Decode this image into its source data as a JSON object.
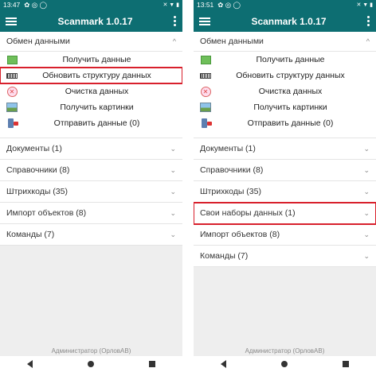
{
  "phones": [
    {
      "time": "13:47",
      "status_icons": "✿ ◎ ◯",
      "sys_icons": "✕ ▼ ▮",
      "app_title": "Scanmark 1.0.17",
      "exchange": {
        "label": "Обмен данными",
        "items": [
          {
            "label": "Получить данные",
            "icon": "device-green-icon"
          },
          {
            "label": "Обновить структуру данных",
            "icon": "barcode-xml-icon"
          },
          {
            "label": "Очистка данных",
            "icon": "clear-icon"
          },
          {
            "label": "Получить картинки",
            "icon": "picture-icon"
          },
          {
            "label": "Отправить данные (0)",
            "icon": "send-icon"
          }
        ]
      },
      "rows": [
        {
          "label": "Документы (1)"
        },
        {
          "label": "Справочники (8)"
        },
        {
          "label": "Штрихкоды (35)"
        },
        {
          "label": "Импорт объектов (8)"
        },
        {
          "label": "Команды (7)"
        }
      ],
      "footer": "Администратор (ОрловАВ)"
    },
    {
      "time": "13:51",
      "status_icons": "✿ ◎ ◯",
      "sys_icons": "✕ ▼ ▮",
      "app_title": "Scanmark 1.0.17",
      "exchange": {
        "label": "Обмен данными",
        "items": [
          {
            "label": "Получить данные",
            "icon": "device-green-icon"
          },
          {
            "label": "Обновить структуру данных",
            "icon": "barcode-xml-icon"
          },
          {
            "label": "Очистка данных",
            "icon": "clear-icon"
          },
          {
            "label": "Получить картинки",
            "icon": "picture-icon"
          },
          {
            "label": "Отправить данные (0)",
            "icon": "send-icon"
          }
        ]
      },
      "rows": [
        {
          "label": "Документы (1)"
        },
        {
          "label": "Справочники (8)"
        },
        {
          "label": "Штрихкоды (35)"
        },
        {
          "label": "Свои наборы данных (1)"
        },
        {
          "label": "Импорт объектов (8)"
        },
        {
          "label": "Команды (7)"
        }
      ],
      "footer": "Администратор (ОрловАВ)"
    }
  ],
  "chevron_up": "^",
  "chevron_down": "⌄",
  "highlight_color": "#d8202c",
  "accent_color": "#0d6e72"
}
